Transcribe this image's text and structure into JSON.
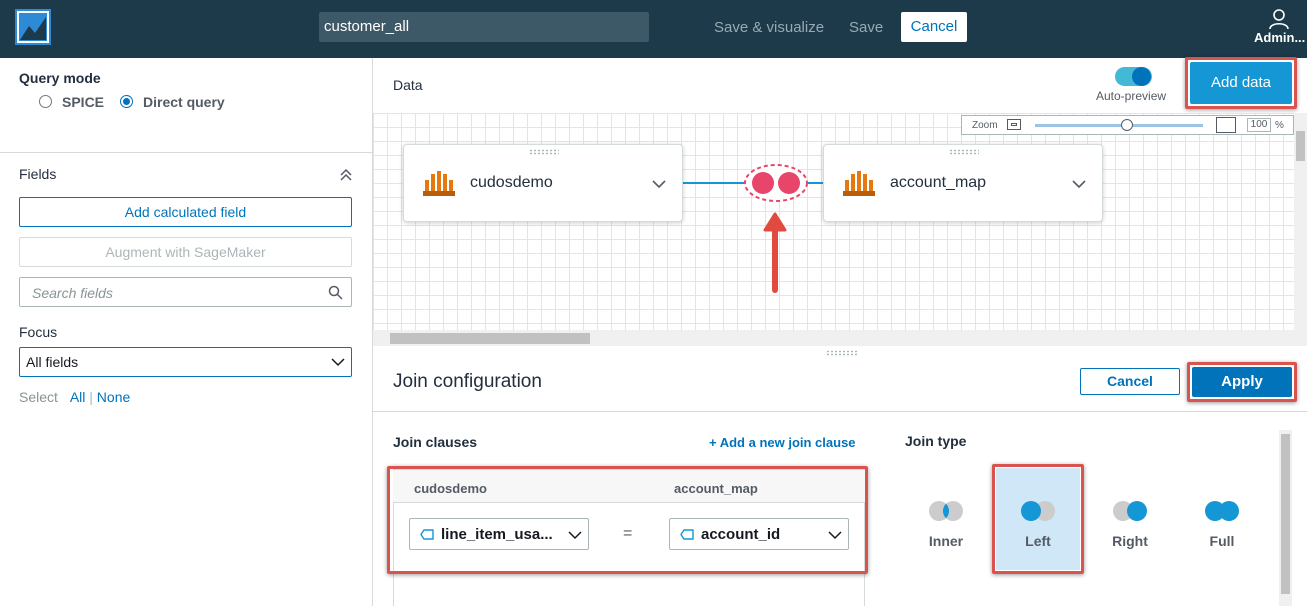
{
  "topbar": {
    "dataset_name": "customer_all",
    "save_visualize_label": "Save & visualize",
    "save_label": "Save",
    "cancel_label": "Cancel",
    "user_label": "Admin..."
  },
  "left": {
    "query_mode_title": "Query mode",
    "spice_label": "SPICE",
    "direct_query_label": "Direct query",
    "fields_title": "Fields",
    "add_calculated_field_label": "Add calculated field",
    "augment_label": "Augment with SageMaker",
    "search_placeholder": "Search fields",
    "focus_title": "Focus",
    "focus_value": "All fields",
    "select_label": "Select",
    "select_all": "All",
    "select_none": "None"
  },
  "data": {
    "title": "Data",
    "auto_preview_label": "Auto-preview",
    "add_data_label": "Add data",
    "zoom_label": "Zoom",
    "zoom_value": "100",
    "zoom_unit": "%",
    "zoom_level": 0.55,
    "nodes": [
      {
        "name": "cudosdemo"
      },
      {
        "name": "account_map"
      }
    ]
  },
  "join": {
    "title": "Join configuration",
    "cancel_label": "Cancel",
    "apply_label": "Apply",
    "clauses_title": "Join clauses",
    "add_clause_label": "+ Add a new join clause",
    "left_dataset": "cudosdemo",
    "right_dataset": "account_map",
    "left_field": "line_item_usa...",
    "operator": "=",
    "right_field": "account_id",
    "join_type_title": "Join type",
    "types": [
      "Inner",
      "Left",
      "Right",
      "Full"
    ],
    "selected_type": "Left"
  },
  "colors": {
    "topbar": "#1c3a4a",
    "accent": "#0073bb",
    "highlight": "#d9534f",
    "join_icon": "#e8456b",
    "selected_bg": "#cfe7f7"
  }
}
